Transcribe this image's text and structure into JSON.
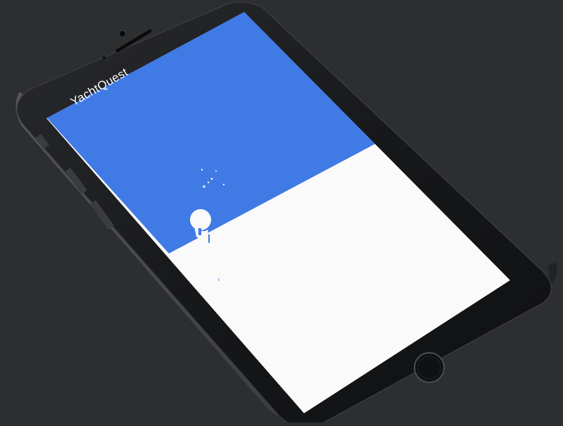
{
  "app": {
    "title": "YachtQuest"
  },
  "colors": {
    "background": "#2d2e30",
    "phone_body": "#1b1c1e",
    "screen_sky": "#407ae4",
    "screen_sea": "#fafafa",
    "title_text": "#ffffff"
  },
  "icons": [
    "sailboat-icon",
    "home-button-icon",
    "front-camera-icon",
    "earpiece-speaker-icon"
  ]
}
